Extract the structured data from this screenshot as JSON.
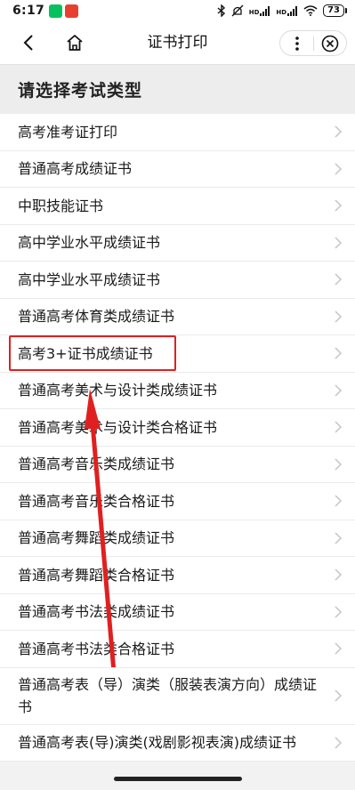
{
  "status_bar": {
    "time": "6:17",
    "app_icons": [
      "wechat-notification-icon",
      "app-notification-icon"
    ],
    "right_icons": [
      "bluetooth-icon",
      "mute-icon",
      "hd-signal-icon",
      "hd-signal-icon",
      "wifi-icon"
    ],
    "hd1": "HD",
    "hd2": "HD",
    "battery": "73"
  },
  "nav": {
    "title": "证书打印",
    "back_icon": "back-arrow-icon",
    "home_icon": "home-icon",
    "more_icon": "more-dots-icon",
    "close_icon": "close-circle-icon"
  },
  "section": {
    "title": "请选择考试类型"
  },
  "items": [
    {
      "label": "高考准考证打印"
    },
    {
      "label": "普通高考成绩证书"
    },
    {
      "label": "中职技能证书"
    },
    {
      "label": "高中学业水平成绩证书"
    },
    {
      "label": "高中学业水平成绩证书"
    },
    {
      "label": "普通高考体育类成绩证书"
    },
    {
      "label": "高考3+证书成绩证书"
    },
    {
      "label": "普通高考美术与设计类成绩证书"
    },
    {
      "label": "普通高考美术与设计类合格证书"
    },
    {
      "label": "普通高考音乐类成绩证书"
    },
    {
      "label": "普通高考音乐类合格证书"
    },
    {
      "label": "普通高考舞蹈类成绩证书"
    },
    {
      "label": "普通高考舞蹈类合格证书"
    },
    {
      "label": "普通高考书法类成绩证书"
    },
    {
      "label": "普通高考书法类合格证书"
    },
    {
      "label": "普通高考表（导）演类（服装表演方向）成绩证书"
    },
    {
      "label": "普通高考表(导)演类(戏剧影视表演)成绩证书"
    }
  ],
  "annotation": {
    "color": "#e02020",
    "highlighted_item": "高考3+证书成绩证书"
  }
}
